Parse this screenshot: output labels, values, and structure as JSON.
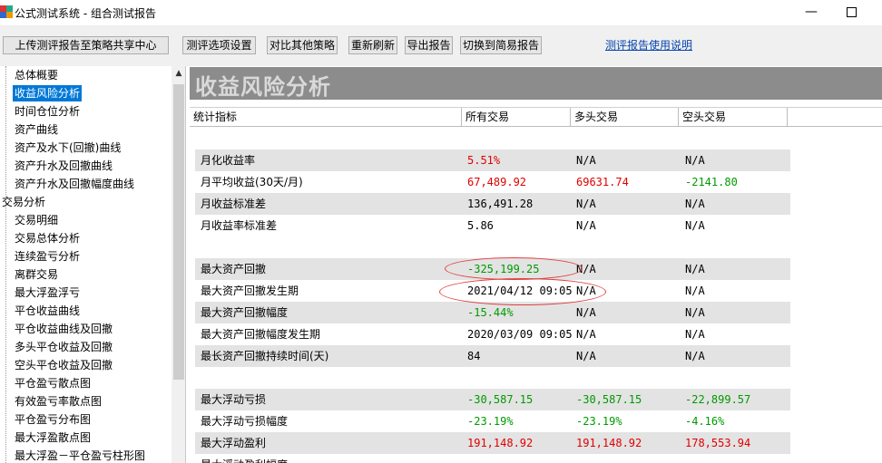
{
  "window": {
    "title": "公式测试系统 - 组合测试报告",
    "minimize": "—"
  },
  "toolbar": {
    "upload": "上传测评报告至策略共享中心",
    "options": "测评选项设置",
    "compare": "对比其他策略",
    "refresh": "重新刷新",
    "export": "导出报告",
    "switch": "切换到简易报告",
    "help": "测评报告使用说明"
  },
  "sidebar": {
    "items": [
      {
        "label": "总体概要"
      },
      {
        "label": "收益风险分析",
        "selected": true
      },
      {
        "label": "时间仓位分析"
      },
      {
        "label": "资产曲线"
      },
      {
        "label": "资产及水下(回撤)曲线"
      },
      {
        "label": "资产升水及回撤曲线"
      },
      {
        "label": "资产升水及回撤幅度曲线"
      },
      {
        "label": "交易分析"
      },
      {
        "label": "交易明细"
      },
      {
        "label": "交易总体分析"
      },
      {
        "label": "连续盈亏分析"
      },
      {
        "label": "离群交易"
      },
      {
        "label": "最大浮盈浮亏"
      },
      {
        "label": "平仓收益曲线"
      },
      {
        "label": "平仓收益曲线及回撤"
      },
      {
        "label": "多头平仓收益及回撤"
      },
      {
        "label": "空头平仓收益及回撤"
      },
      {
        "label": "平仓盈亏散点图"
      },
      {
        "label": "有效盈亏率散点图"
      },
      {
        "label": "平仓盈亏分布图"
      },
      {
        "label": "最大浮盈散点图"
      },
      {
        "label": "最大浮盈－平仓盈亏柱形图"
      }
    ]
  },
  "report": {
    "title": "收益风险分析",
    "headers": [
      "统计指标",
      "所有交易",
      "多头交易",
      "空头交易"
    ],
    "rows": [
      {
        "label": "月化收益率",
        "all": "5.51%",
        "long": "N/A",
        "short": "N/A",
        "c": [
          "red",
          "black",
          "black"
        ]
      },
      {
        "label": "月平均收益(30天/月)",
        "all": "67,489.92",
        "long": "69631.74",
        "short": "-2141.80",
        "c": [
          "red",
          "red",
          "green"
        ]
      },
      {
        "label": "月收益标准差",
        "all": "136,491.28",
        "long": "N/A",
        "short": "N/A",
        "c": [
          "black",
          "black",
          "black"
        ]
      },
      {
        "label": "月收益率标准差",
        "all": "5.86",
        "long": "N/A",
        "short": "N/A",
        "c": [
          "black",
          "black",
          "black"
        ]
      },
      {
        "label": "最大资产回撤",
        "all": "-325,199.25",
        "long": "N/A",
        "short": "N/A",
        "c": [
          "green",
          "black",
          "black"
        ]
      },
      {
        "label": "最大资产回撤发生期",
        "all": "2021/04/12 09:05",
        "long": "N/A",
        "short": "N/A",
        "c": [
          "black",
          "black",
          "black"
        ]
      },
      {
        "label": "最大资产回撤幅度",
        "all": "-15.44%",
        "long": "N/A",
        "short": "N/A",
        "c": [
          "green",
          "black",
          "black"
        ]
      },
      {
        "label": "最大资产回撤幅度发生期",
        "all": "2020/03/09 09:05",
        "long": "N/A",
        "short": "N/A",
        "c": [
          "black",
          "black",
          "black"
        ]
      },
      {
        "label": "最长资产回撤持续时间(天)",
        "all": "84",
        "long": "N/A",
        "short": "N/A",
        "c": [
          "black",
          "black",
          "black"
        ]
      },
      {
        "label": "最大浮动亏损",
        "all": "-30,587.15",
        "long": "-30,587.15",
        "short": "-22,899.57",
        "c": [
          "green",
          "green",
          "green"
        ]
      },
      {
        "label": "最大浮动亏损幅度",
        "all": "-23.19%",
        "long": "-23.19%",
        "short": "-4.16%",
        "c": [
          "green",
          "green",
          "green"
        ]
      },
      {
        "label": "最大浮动盈利",
        "all": "191,148.92",
        "long": "191,148.92",
        "short": "178,553.94",
        "c": [
          "red",
          "red",
          "red"
        ]
      },
      {
        "label": "最大浮动盈利幅度",
        "all": "",
        "long": "",
        "short": "",
        "c": [
          "red",
          "red",
          "red"
        ]
      }
    ]
  },
  "colors": {
    "red": "#e00000",
    "green": "#009a00",
    "selected": "#0078d7",
    "banner": "#8c8c8c"
  }
}
